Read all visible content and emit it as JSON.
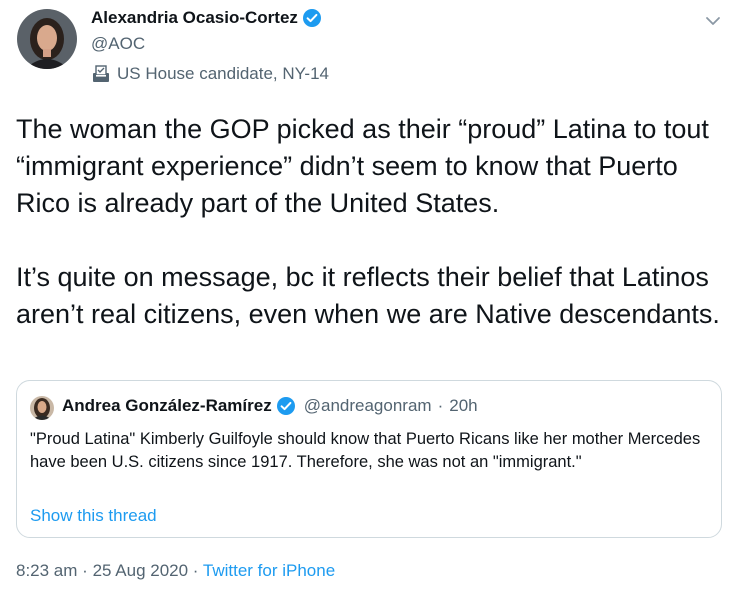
{
  "tweet": {
    "author_name": "Alexandria Ocasio-Cortez",
    "handle": "@AOC",
    "label": "US House candidate, NY-14",
    "text": "The woman the GOP picked as their “proud” Latina to tout “immigrant experience” didn’t seem to know that Puerto Rico is already part of the United States.\n\nIt’s quite on message, bc it reflects their belief that Latinos aren’t real citizens, even when we are Native descendants.",
    "icons": [
      "avatar",
      "verified-badge-icon",
      "ballot-box-icon",
      "chevron-down-icon"
    ]
  },
  "quote": {
    "author_name": "Andrea González-Ramírez",
    "handle": "@andreagonram",
    "sep": "·",
    "time": "20h",
    "text": "\"Proud Latina\" Kimberly Guilfoyle should know that Puerto Ricans like her mother Mercedes have been U.S. citizens since 1917. Therefore, she was not an \"immigrant.\"",
    "link": "Show this thread"
  },
  "footer": {
    "time": "8:23 am",
    "sep1": "·",
    "date": "25 Aug 2020",
    "sep2": "·",
    "source": "Twitter for iPhone"
  },
  "colors": {
    "link": "#1d9bf0",
    "secondary_text": "#536471",
    "border": "#cfd9de",
    "primary_text": "#0f1419"
  }
}
